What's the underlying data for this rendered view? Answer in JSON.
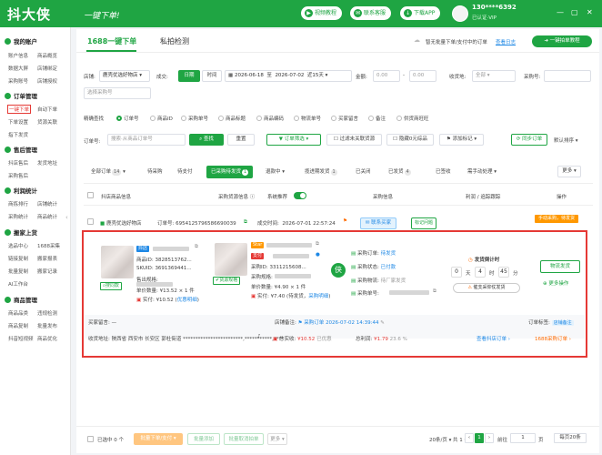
{
  "app": {
    "logo": "抖大侠",
    "slogan": "一键下单!",
    "top_buttons": [
      {
        "label": "视频教程",
        "icon": "play-icon"
      },
      {
        "label": "联系客服",
        "icon": "chat-icon"
      },
      {
        "label": "下载APP",
        "icon": "download-icon"
      }
    ],
    "user_phone": "130****6392",
    "user_sub": "已认证·VIP",
    "window_controls": [
      "—",
      "▢",
      "✕"
    ]
  },
  "sidebar": {
    "sections": [
      {
        "title": "我的账户",
        "items": [
          "账户信息",
          "商品概览",
          "数据大屏",
          "店铺绑定",
          "采购账号",
          "店铺授权"
        ]
      },
      {
        "title": "订单管理",
        "items": [
          "一键下单",
          "自动下单",
          "下单设置",
          "货源关联",
          "指下发货"
        ]
      },
      {
        "title": "售后管理",
        "items": [
          "抖店售后",
          "发货地址",
          "采购售后"
        ]
      },
      {
        "title": "利润统计",
        "items": [
          "商拣排行",
          "店铺统计",
          "采购统计",
          "商品统计"
        ]
      },
      {
        "title": "搬家上货",
        "items": [
          "选品中心",
          "1688采集",
          "链接复制",
          "搬家报表",
          "批量复制",
          "搬家记录",
          "AI工作台"
        ]
      },
      {
        "title": "商品管理",
        "items": [
          "商品品类",
          "违规检测",
          "商品复制",
          "批量发布",
          "抖音短视频",
          "商品优化"
        ]
      }
    ],
    "active_item": "一键下单"
  },
  "tabs": [
    "1688一键下单",
    "私拍检测"
  ],
  "notice": {
    "text": "智无批量下单/支付中的订单",
    "link": "查看日志"
  },
  "order_btn": "一键拍单教程",
  "filters": {
    "shop_label": "店铺:",
    "shop_value": "鹿壳优选好物店",
    "time_label": "成交:",
    "day_btn": "日期",
    "time_btn": "时间",
    "date_start": "2026-06-18",
    "date_sep": "至",
    "date_end": "2026-07-02",
    "range": "近15天",
    "amount_label": "金额:",
    "amount_min": "0.00",
    "amount_sep": "-",
    "amount_max": "0.00",
    "goods_label": "收货地:",
    "goods_ph": "全部",
    "buyer_label": "采购号:",
    "buyer_ph": "选择采购号",
    "search_mode_label": "精确查找",
    "modes": [
      "订单号",
      "商品ID",
      "采购单号",
      "商品标题",
      "商品编码",
      "物流单号",
      "买家留言",
      "备注",
      "供货商旺旺"
    ],
    "order_label": "订单号:",
    "order_ph": "搜索·从商品订单号",
    "query_btn": "查找",
    "reset_btn": "重置",
    "order_filter_btn": "订单筛选",
    "unlinked": "过滤未关联货源",
    "hide_zero": "隐藏0元综品",
    "mark_btn": "添加标记",
    "sync_btn": "同步订单",
    "sort": "默认排序"
  },
  "status_tabs": [
    {
      "label": "全部订单",
      "count": "14"
    },
    {
      "label": "待采购",
      "count": ""
    },
    {
      "label": "待支付",
      "count": ""
    },
    {
      "label": "已采购待发货",
      "count": "1"
    },
    {
      "label": "退款中",
      "count": ""
    },
    {
      "label": "揽进期发货",
      "count": "1"
    },
    {
      "label": "已关闭",
      "count": ""
    },
    {
      "label": "已发货",
      "count": "4"
    },
    {
      "label": "已签收",
      "count": ""
    },
    {
      "label": "需手动处理",
      "count": ""
    }
  ],
  "more_btn": "更多",
  "table_head": {
    "product": "抖店商品信息",
    "source": "采购货源信息",
    "recommend": "系统推荐",
    "purchase": "采购信息",
    "status": "利润 / 追踪跟踪",
    "action": "操作"
  },
  "order": {
    "shop": "鹿壳优选好物店",
    "order_no_label": "订单号:",
    "order_no": "6954125796586690039",
    "deal_time_label": "成交时间:",
    "deal_time": "2026-07-01 22:57:24",
    "contact_btn": "联系买家",
    "tag_btn": "标记问题",
    "corner_tag": "手动采购，待发货",
    "left_item": {
      "badge": "抖店",
      "id_label": "商品ID:",
      "id": "3828513762...",
      "sku_label": "SKUID:",
      "sku": "3691369441...",
      "attr_label": "售出规格:",
      "qty_label": "单价数量:",
      "qty": "¥13.52 × 1 件",
      "paid_label": "实付:",
      "paid": "¥10.52 (",
      "coupon": "优惠明细",
      "close": ")",
      "search_tag": "搜同款"
    },
    "right_item": {
      "badge": "Star",
      "buyer": "支付",
      "id_label": "采购ID:",
      "id": "3311215608...",
      "attr_label": "采购规格:",
      "qty_label": "单价数量:",
      "qty": "¥4.90 × 1 件",
      "paid_label": "实付:",
      "paid": "¥7.40 (待发货，",
      "link": "采购明细",
      "close": ")",
      "tag": "货源规格"
    },
    "purchase_rows": [
      {
        "label": "采购订单:",
        "value": "待发货"
      },
      {
        "label": "采购状态:",
        "value": "已付款"
      },
      {
        "label": "采购物流:",
        "value": "待厂家发货"
      },
      {
        "label": "采购单号:",
        "value": ""
      }
    ],
    "countdown": {
      "title": "发货倒计时",
      "d": "0",
      "d_label": "天",
      "h": "4",
      "h_label": "时",
      "m": "45",
      "m_label": "分",
      "btn": "催支采仰仗发货"
    },
    "ship_btn": "物流发货",
    "more_ops": "更多操作",
    "buyer_msg_label": "买家留言:",
    "buyer_msg": "—",
    "shop_remark_label": "店铺备注:",
    "shop_remark": "采购订单",
    "remark_time": "2026-07-02 14:39:44",
    "order_flag_label": "订单标签:",
    "order_flag": "店铺备注",
    "addr_label": "收货地址:",
    "addr": "陕西省 西安市 长安区 郭杜街道 ************************,***********,****",
    "total_label": "总实收:",
    "total": "¥10.52",
    "discount": "已优惠",
    "profit_label": "总利润:",
    "profit": "¥1.79",
    "profit_pct": "23.6 %",
    "jump_btn": "查看抖店订单",
    "jump2": "1688采购订单"
  },
  "footer": {
    "select_label": "已选中 0 个",
    "bulk_order": "批量下单/支付",
    "bulk_mark": "批量添加",
    "bulk_cancel": "批量取消拍单",
    "bulk_more": "更多",
    "page_size": "20条/页",
    "total": "共 1 条",
    "cur": "1",
    "goto_label": "前往",
    "goto_val": "1",
    "page_word": "页",
    "pages_btn": "每页20条"
  }
}
